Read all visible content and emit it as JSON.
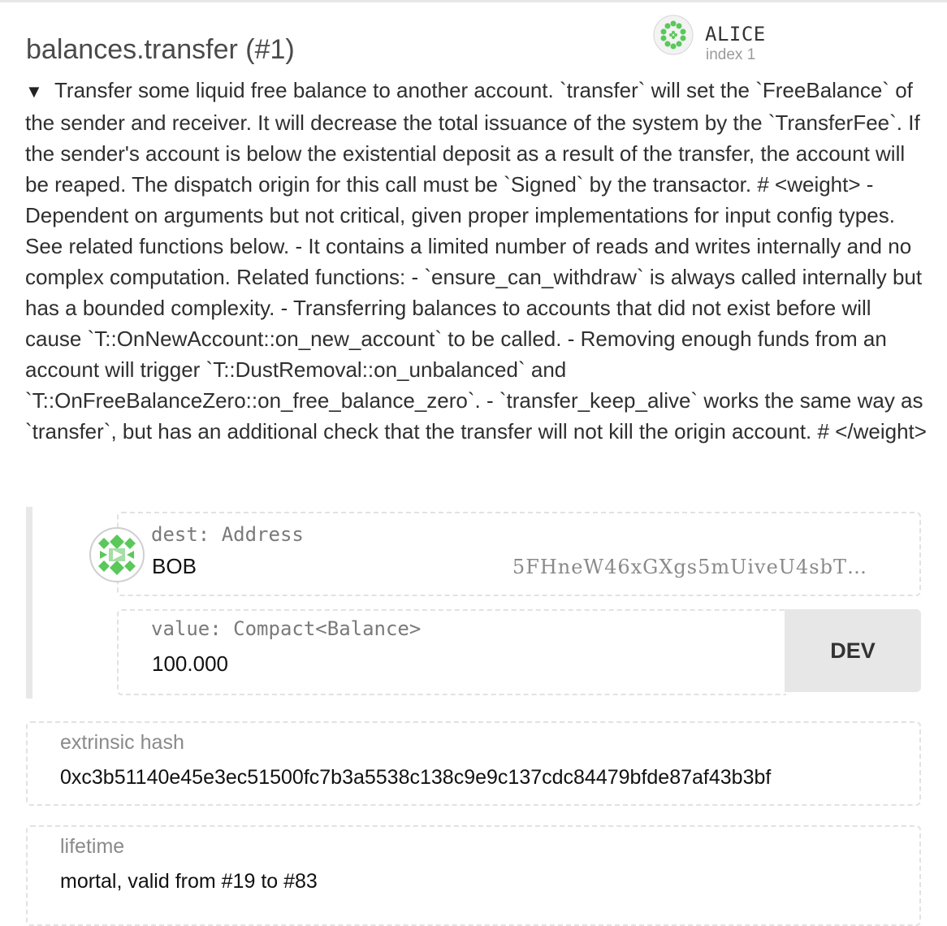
{
  "call": {
    "title": "balances.transfer (#1)",
    "expand_glyph": "▼",
    "documentation": "Transfer some liquid free balance to another account. `transfer` will set the `FreeBalance` of the sender and receiver. It will decrease the total issuance of the system by the `TransferFee`. If the sender's account is below the existential deposit as a result of the transfer, the account will be reaped. The dispatch origin for this call must be `Signed` by the transactor. # <weight> - Dependent on arguments but not critical, given proper implementations for input config types. See related functions below. - It contains a limited number of reads and writes internally and no complex computation. Related functions: - `ensure_can_withdraw` is always called internally but has a bounded complexity. - Transferring balances to accounts that did not exist before will cause `T::OnNewAccount::on_new_account` to be called. - Removing enough funds from an account will trigger `T::DustRemoval::on_unbalanced` and `T::OnFreeBalanceZero::on_free_balance_zero`. - `transfer_keep_alive` works the same way as `transfer`, but has an additional check that the transfer will not kill the origin account. # </weight>"
  },
  "signer": {
    "name": "ALICE",
    "index_label": "index 1",
    "avatar_icon": "polkadot-identicon-icon"
  },
  "params": {
    "dest": {
      "label": "dest: Address",
      "name": "BOB",
      "address": "5FHneW46xGXgs5mUiveU4sbT…",
      "avatar_icon": "polkadot-identicon-icon"
    },
    "value": {
      "label": "value: Compact<Balance>",
      "amount": "100.000",
      "unit": "DEV"
    }
  },
  "extrinsic_hash": {
    "label": "extrinsic hash",
    "value": "0xc3b51140e45e3ec51500fc7b3a5538c138c9e9c137cdc84479bfde87af43b3bf"
  },
  "lifetime": {
    "label": "lifetime",
    "value": "mortal, valid from #19 to #83"
  },
  "colors": {
    "identicon_green": "#5ac85a",
    "field_border": "#e2e2e2",
    "unit_bg": "#e7e7e7"
  }
}
